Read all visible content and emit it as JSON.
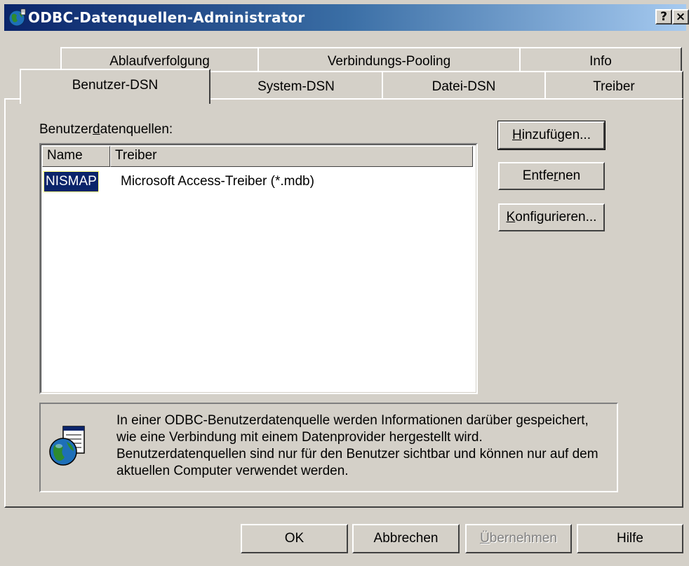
{
  "window": {
    "title": "ODBC-Datenquellen-Administrator",
    "help_button": "?",
    "close_button": "×",
    "icon": "odbc-globe-icon"
  },
  "tabs": {
    "back_row": [
      {
        "label": "Ablaufverfolgung"
      },
      {
        "label": "Verbindungs-Pooling"
      },
      {
        "label": "Info"
      }
    ],
    "front_row": [
      {
        "label": "Benutzer-DSN",
        "selected": true
      },
      {
        "label": "System-DSN"
      },
      {
        "label": "Datei-DSN"
      },
      {
        "label": "Treiber"
      }
    ]
  },
  "panel": {
    "list_label_pre": "Benutzer",
    "list_label_mnemonic": "d",
    "list_label_post": "atenquellen:",
    "columns": [
      "Name",
      "Treiber"
    ],
    "rows": [
      {
        "name": "NISMAP",
        "driver": "Microsoft Access-Treiber (*.mdb)",
        "selected": true
      }
    ],
    "buttons": {
      "add": {
        "mnemonic": "H",
        "rest": "inzufügen..."
      },
      "remove": {
        "pre": "Entfe",
        "mnemonic": "r",
        "post": "nen"
      },
      "configure": {
        "mnemonic": "K",
        "rest": "onfigurieren..."
      }
    },
    "info_icon": "odbc-datasource-icon",
    "info_text": "In einer ODBC-Benutzerdatenquelle werden Informationen darüber gespeichert, wie eine Verbindung mit einem Datenprovider hergestellt wird. Benutzerdatenquellen sind nur für den Benutzer sichtbar und können nur auf dem aktuellen Computer verwendet werden."
  },
  "footer": {
    "ok": "OK",
    "cancel": "Abbrechen",
    "apply_mnemonic": "Ü",
    "apply_rest": "bernehmen",
    "apply_disabled": true,
    "help": "Hilfe"
  },
  "colors": {
    "face": "#d4d0c8",
    "title_start": "#0a246a",
    "title_end": "#a6caf0",
    "selection": "#0a246a"
  }
}
